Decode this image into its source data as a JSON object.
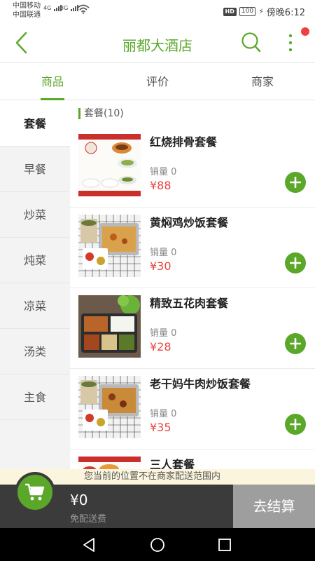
{
  "status": {
    "carrier1": "中国移动",
    "carrier2": "中国联通",
    "net1": "4G",
    "net2": "3G",
    "hd": "HD",
    "battery": "100",
    "time": "傍晚6:12"
  },
  "header": {
    "title": "丽都大酒店"
  },
  "tabs": [
    {
      "label": "商品"
    },
    {
      "label": "评价"
    },
    {
      "label": "商家"
    }
  ],
  "sidebar": {
    "items": [
      {
        "label": "套餐"
      },
      {
        "label": "早餐"
      },
      {
        "label": "炒菜"
      },
      {
        "label": "炖菜"
      },
      {
        "label": "凉菜"
      },
      {
        "label": "汤类"
      },
      {
        "label": "主食"
      }
    ]
  },
  "main": {
    "section_title": "套餐(10)",
    "items": [
      {
        "name": "红烧排骨套餐",
        "sales": "销量 0",
        "price": "¥88"
      },
      {
        "name": "黄焖鸡炒饭套餐",
        "sales": "销量 0",
        "price": "¥30"
      },
      {
        "name": "精致五花肉套餐",
        "sales": "销量 0",
        "price": "¥28"
      },
      {
        "name": "老干妈牛肉炒饭套餐",
        "sales": "销量 0",
        "price": "¥35"
      },
      {
        "name": "三人套餐"
      }
    ]
  },
  "notice": "您当前的位置不在商家配送范围内",
  "cart": {
    "total": "¥0",
    "fee": "免配送费",
    "checkout_label": "去结算"
  },
  "colors": {
    "accent": "#5aa72a",
    "price": "#e8453c",
    "badge": "#ef3f3f"
  }
}
